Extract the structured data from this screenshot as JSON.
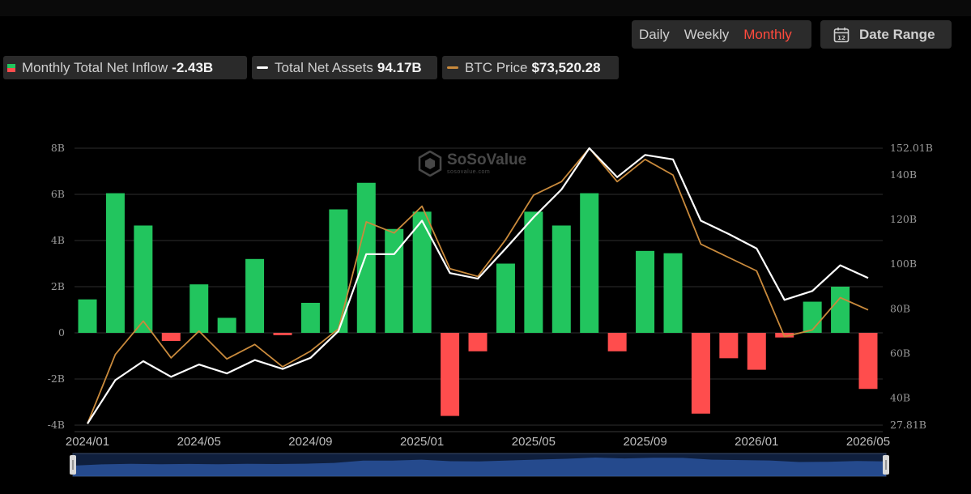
{
  "controls": {
    "periods": [
      "Daily",
      "Weekly",
      "Monthly"
    ],
    "active_period": "Monthly",
    "date_range_label": "Date Range",
    "date_range_icon_text": "12"
  },
  "legend": {
    "inflow": {
      "label": "Monthly Total Net Inflow",
      "value": "-2.43B"
    },
    "assets": {
      "label": "Total Net Assets",
      "value": "94.17B"
    },
    "btc": {
      "label": "BTC Price",
      "value": "$73,520.28"
    }
  },
  "watermark": {
    "brand": "SoSoValue",
    "url": "sosovalue.com"
  },
  "colors": {
    "positive_bar": "#22c55e",
    "negative_bar": "#ff4d4d",
    "net_assets_line": "#ffffff",
    "btc_line": "#c98a3c",
    "active_tab": "#ff4a3d"
  },
  "chart_data": {
    "type": "bar",
    "title": "",
    "x_tick_labels": [
      "2024/01",
      "2024/05",
      "2024/09",
      "2025/01",
      "2025/05",
      "2025/09",
      "2026/01",
      "2026/05"
    ],
    "left_axis": {
      "ticks": [
        "8B",
        "6B",
        "4B",
        "2B",
        "0",
        "-2B",
        "-4B"
      ],
      "ylim": [
        -4,
        8
      ],
      "unit": "B"
    },
    "right_axis": {
      "ticks": [
        "152.01B",
        "140B",
        "120B",
        "100B",
        "80B",
        "60B",
        "40B",
        "27.81B"
      ],
      "ylim": [
        27.81,
        152.01
      ],
      "unit": "B"
    },
    "grid": true,
    "legend_position": "top-left",
    "months": [
      "2024/01",
      "2024/02",
      "2024/03",
      "2024/04",
      "2024/05",
      "2024/06",
      "2024/07",
      "2024/08",
      "2024/09",
      "2024/10",
      "2024/11",
      "2024/12",
      "2025/01",
      "2025/02",
      "2025/03",
      "2025/04",
      "2025/05",
      "2025/06",
      "2025/07",
      "2025/08",
      "2025/09",
      "2025/10",
      "2025/11",
      "2025/12",
      "2026/01",
      "2026/02",
      "2026/03",
      "2026/04",
      "2026/05"
    ],
    "series": [
      {
        "name": "Monthly Total Net Inflow",
        "kind": "bar",
        "axis": "left",
        "values": [
          1.45,
          6.05,
          4.65,
          -0.35,
          2.1,
          0.65,
          3.2,
          -0.1,
          1.3,
          5.35,
          6.5,
          4.5,
          5.25,
          -3.6,
          -0.8,
          3.0,
          5.25,
          4.65,
          6.05,
          -0.8,
          3.55,
          3.45,
          -3.5,
          -1.1,
          -1.6,
          -0.2,
          1.35,
          2.0,
          -2.43
        ]
      },
      {
        "name": "Total Net Assets",
        "kind": "line",
        "axis": "right",
        "values": [
          28.5,
          48,
          56.5,
          49.5,
          55,
          51,
          57,
          53,
          58,
          70,
          104.5,
          104.5,
          119.5,
          96,
          93.5,
          107,
          121,
          133.5,
          152,
          139,
          149,
          147,
          119.5,
          113.5,
          107,
          84,
          88,
          99.5,
          93.8
        ]
      },
      {
        "name": "BTC Price",
        "kind": "line",
        "axis": "right",
        "values": [
          28.5,
          59.5,
          74.5,
          58,
          70,
          57.5,
          64,
          54,
          61,
          71,
          119,
          114,
          126,
          98,
          94.5,
          111,
          131,
          137,
          152,
          137,
          147,
          140,
          109,
          103,
          97,
          67.5,
          70.5,
          85,
          79.5
        ]
      }
    ]
  }
}
